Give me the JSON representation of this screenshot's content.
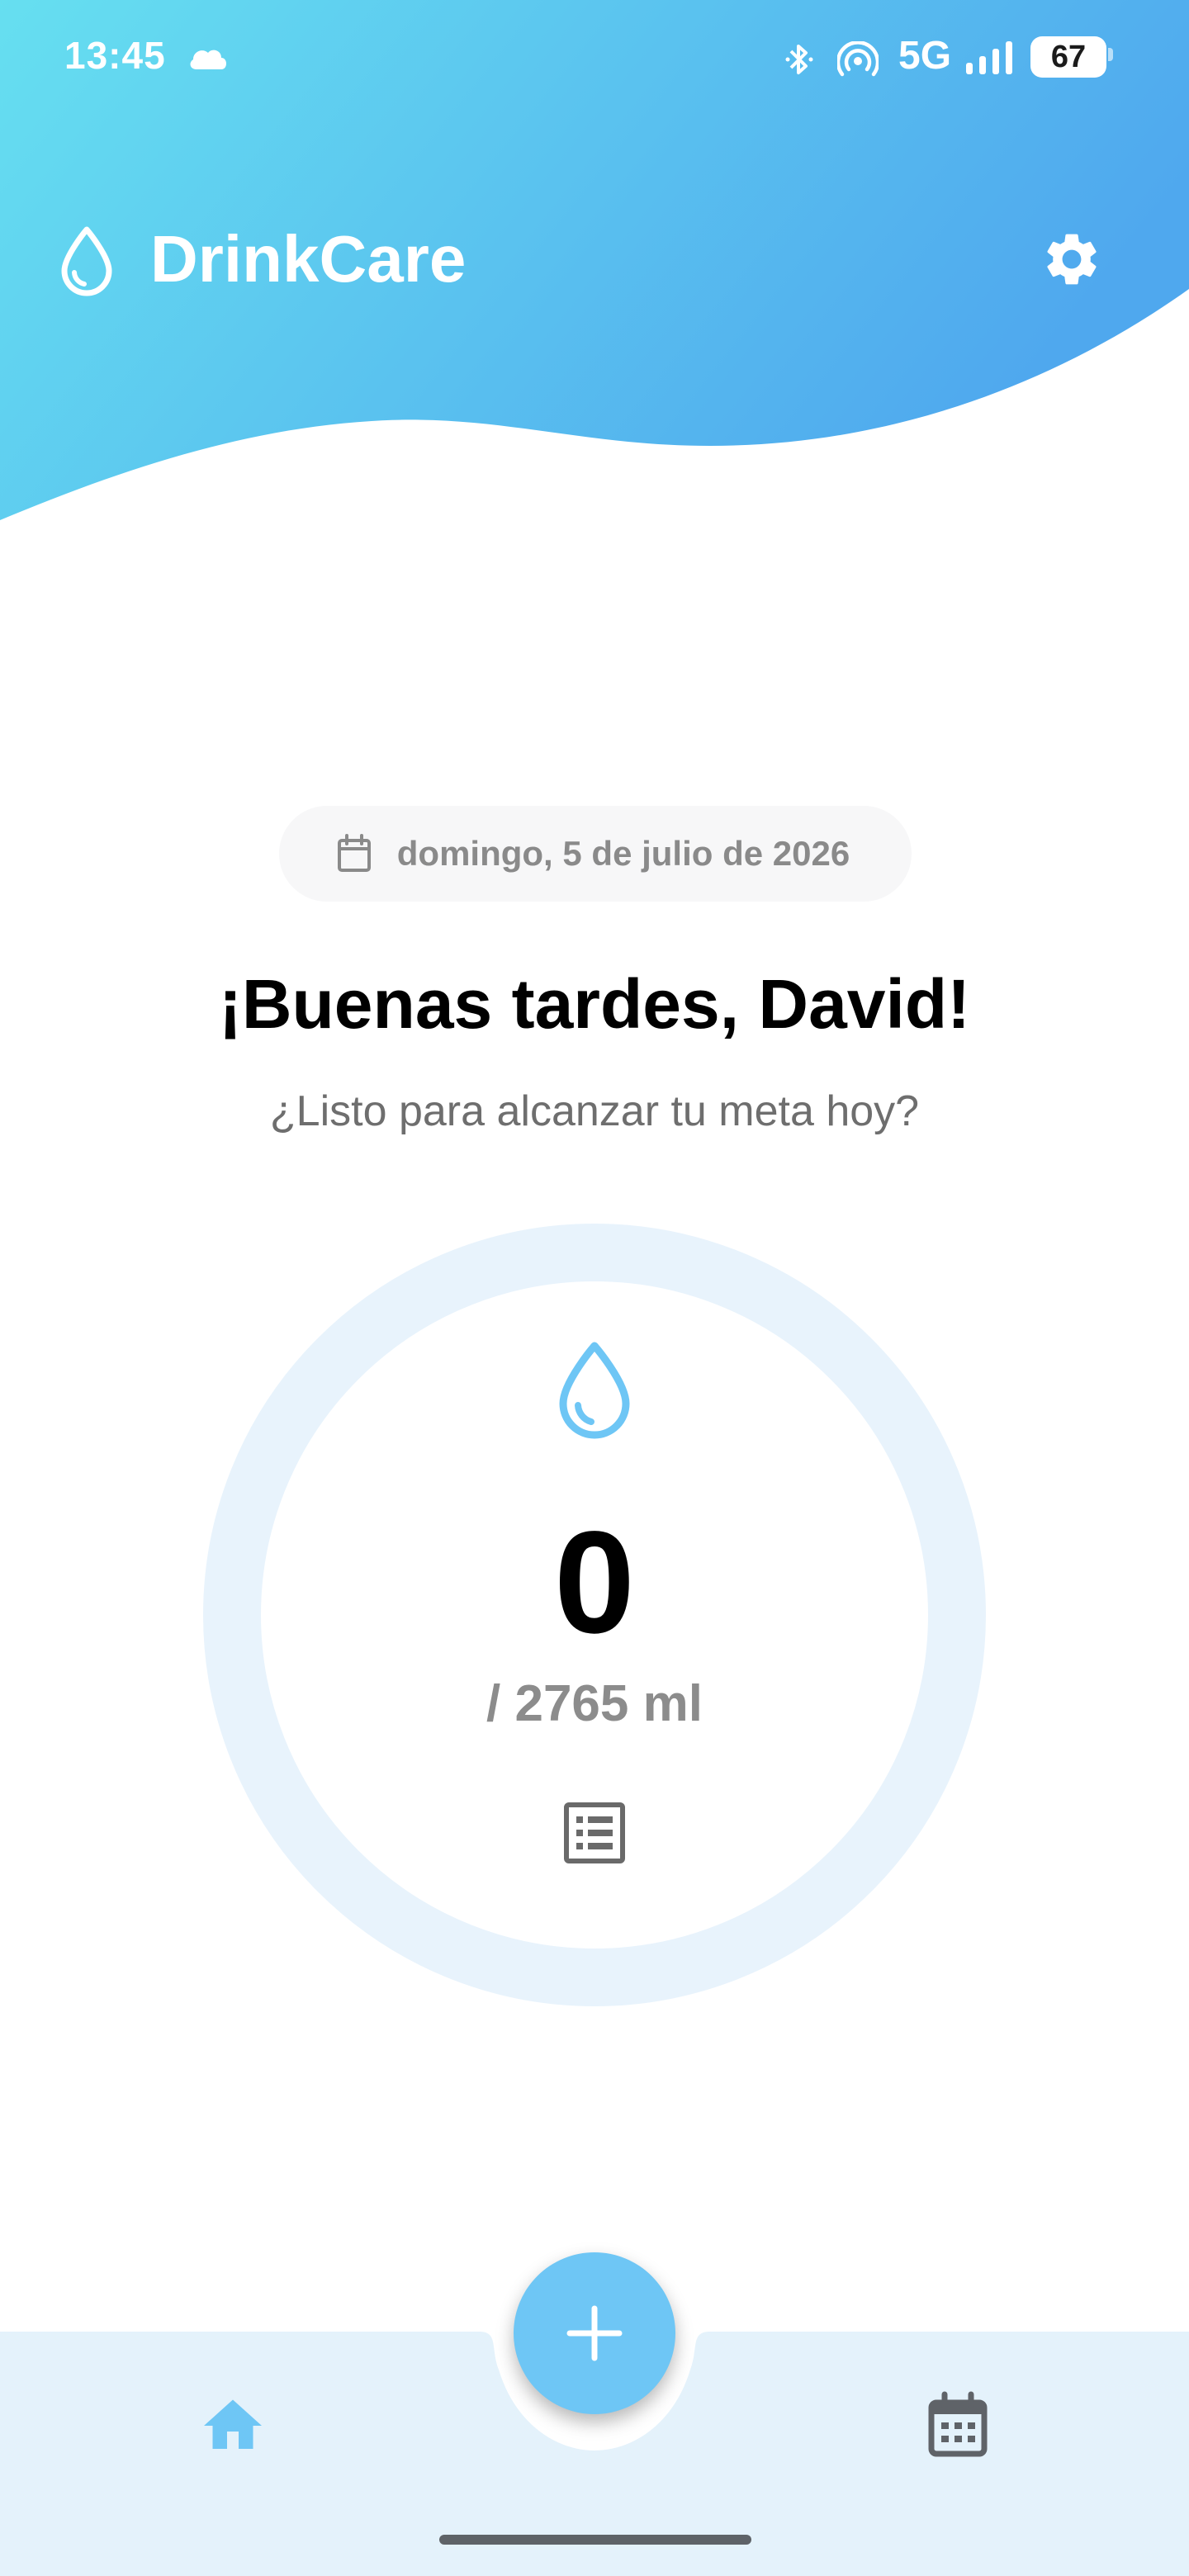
{
  "status_bar": {
    "time": "13:45",
    "network": "5G",
    "battery": "67",
    "icons": [
      "cloud-icon",
      "bluetooth-icon",
      "hotspot-icon",
      "signal-icon",
      "battery-icon"
    ]
  },
  "app_bar": {
    "title": "DrinkCare",
    "logo_icon": "water-drop-outline-icon",
    "settings_icon": "gear-icon"
  },
  "date": {
    "icon": "calendar-icon",
    "text": "domingo, 5 de julio de 2026"
  },
  "greeting": {
    "title": "¡Buenas tardes, David!",
    "subtitle": "¿Listo para alcanzar tu meta hoy?"
  },
  "progress": {
    "current": "0",
    "goal_text": "/ 2765 ml",
    "fraction": 0,
    "icon": "water-drop-icon",
    "history_icon": "list-icon"
  },
  "bottom_nav": {
    "items": [
      {
        "name": "home",
        "icon": "home-icon",
        "active": true
      },
      {
        "name": "calendar",
        "icon": "calendar-icon",
        "active": false
      }
    ],
    "fab_icon": "plus-icon"
  },
  "colors": {
    "gradient_start": "#64dcf0",
    "gradient_end": "#50aaee",
    "accent": "#6ec6f5",
    "ring_track": "#e8f3fc",
    "nav_bg": "#e4f2fb",
    "icon_gray": "#6a6a6a"
  }
}
